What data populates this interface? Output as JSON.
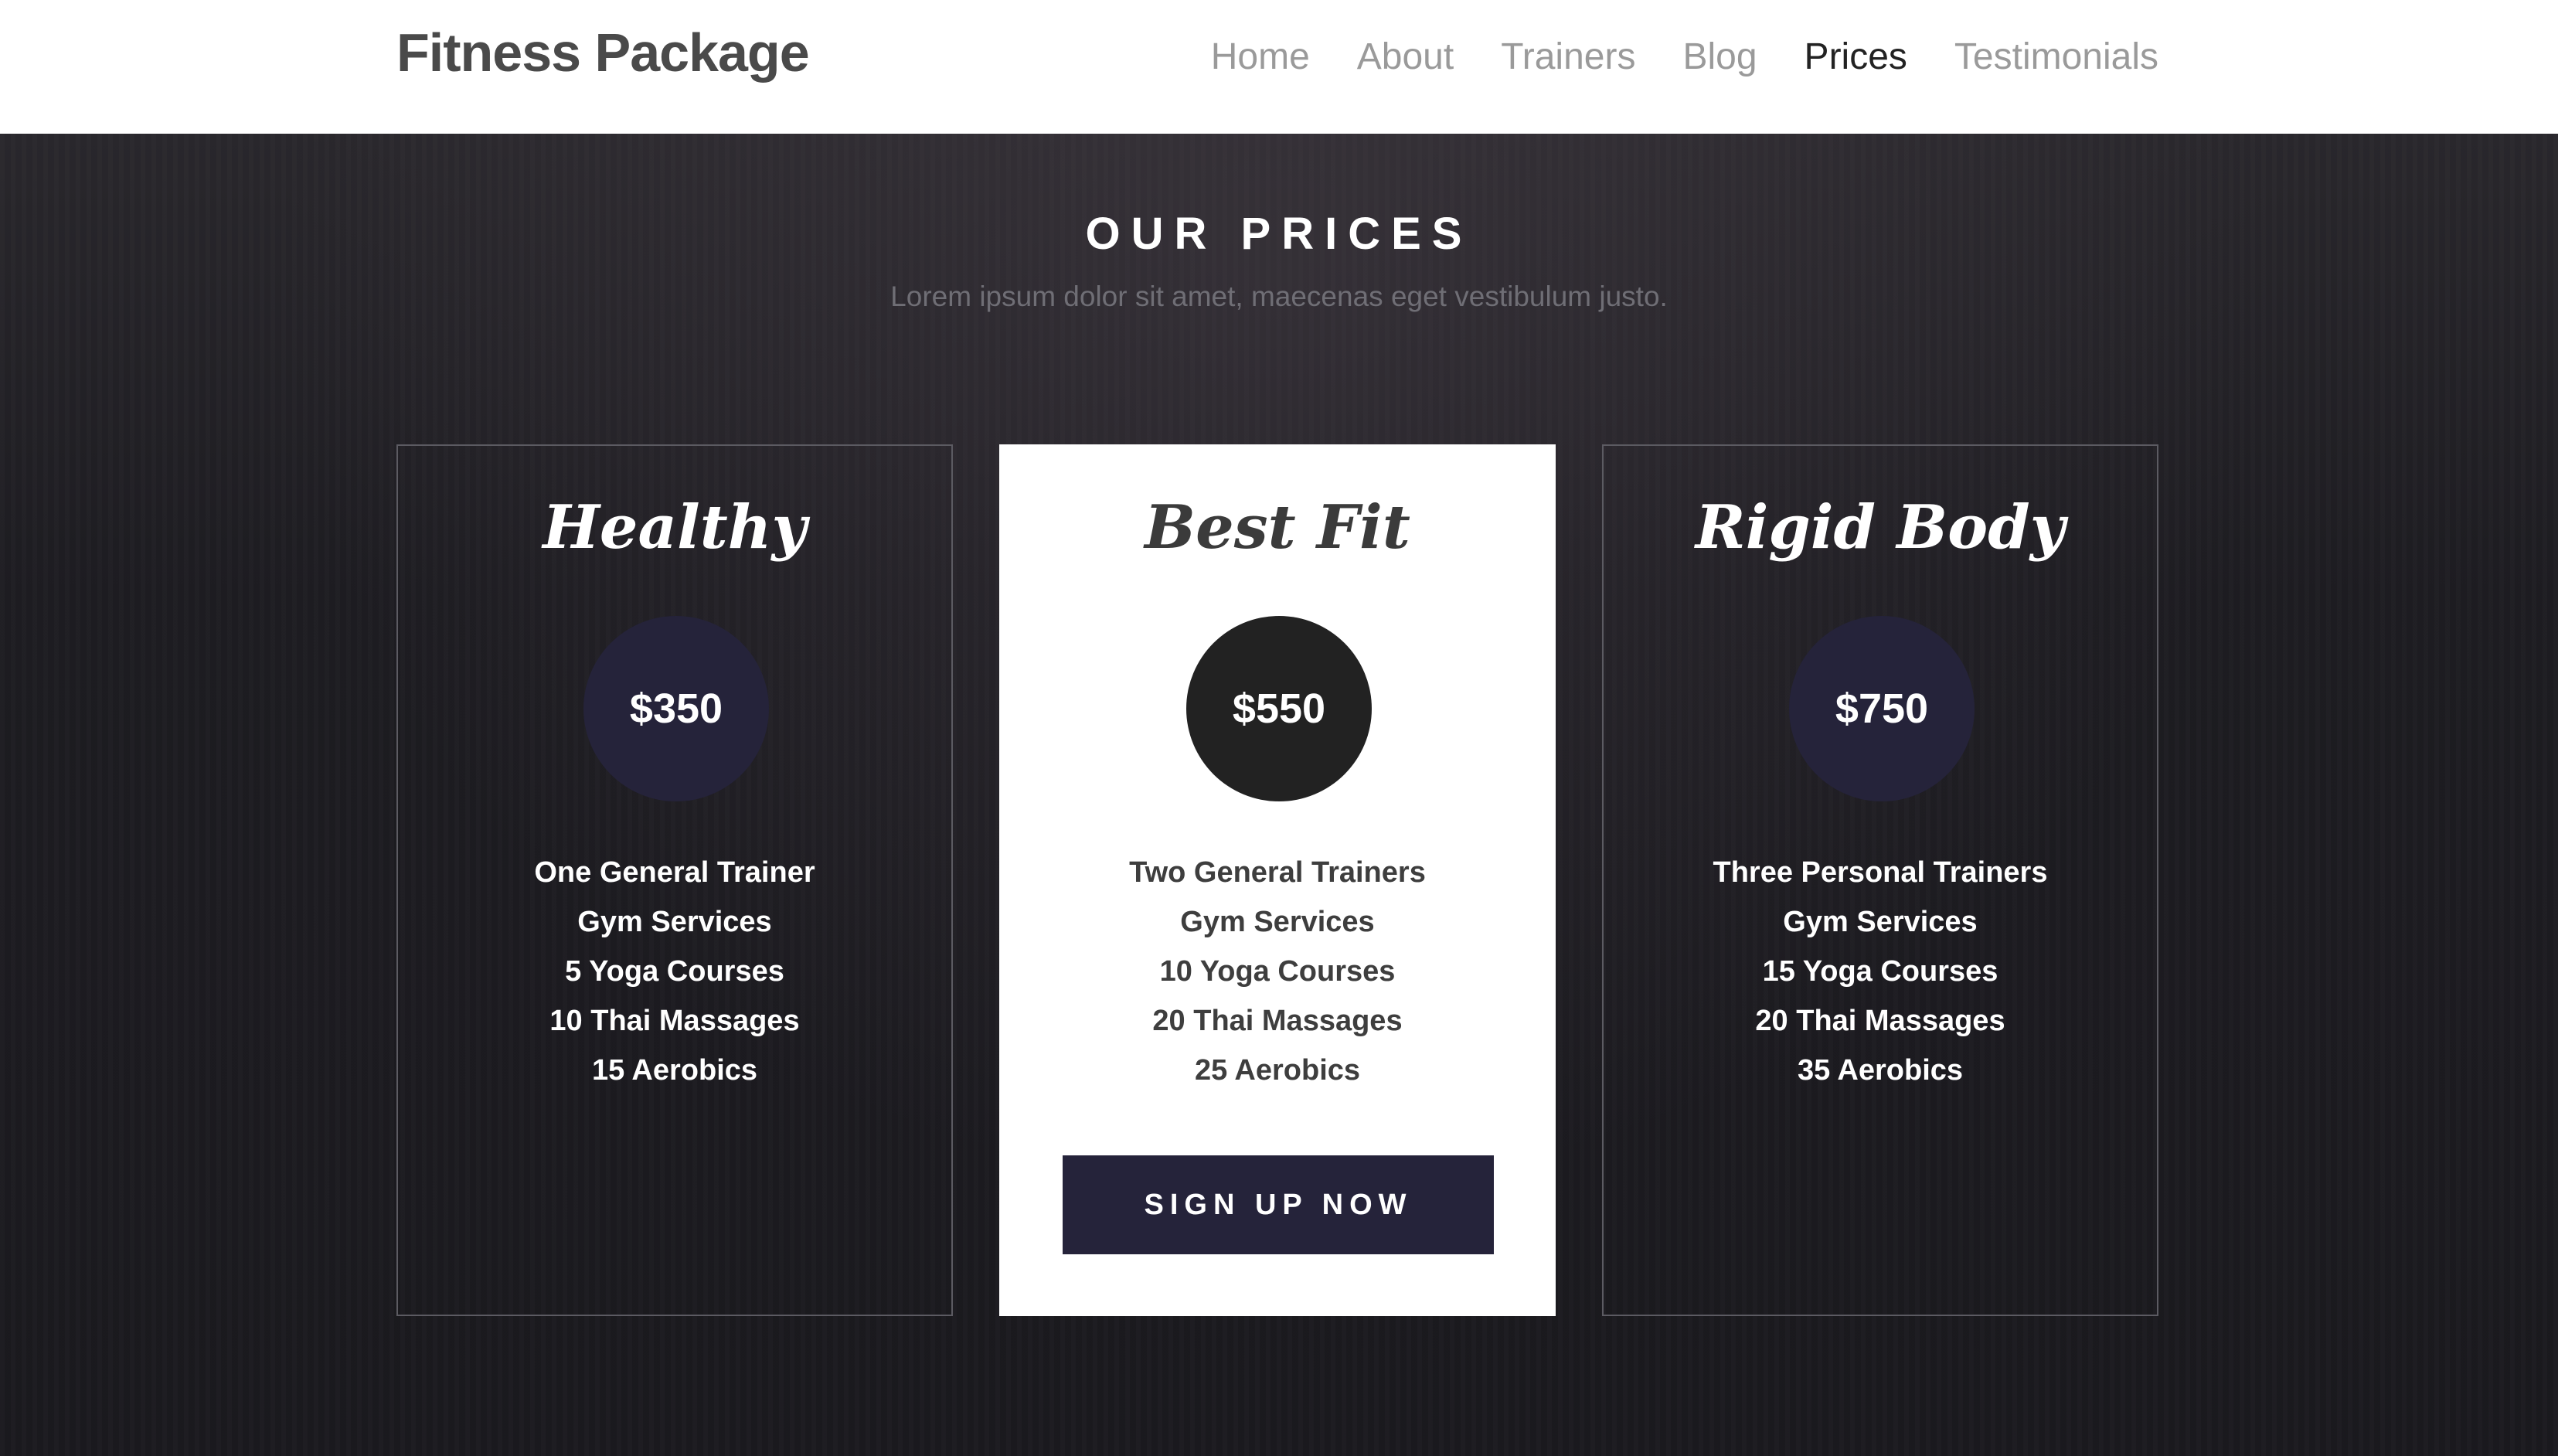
{
  "header": {
    "brand": "Fitness Package",
    "nav": [
      "Home",
      "About",
      "Trainers",
      "Blog",
      "Prices",
      "Testimonials"
    ],
    "active_nav": "Prices"
  },
  "prices": {
    "title": "OUR PRICES",
    "subtitle": "Lorem ipsum dolor sit amet, maecenas eget vestibulum justo.",
    "plans": [
      {
        "name": "Healthy",
        "price": "$350",
        "features": [
          "One General Trainer",
          "Gym Services",
          "5 Yoga Courses",
          "10 Thai Massages",
          "15 Aerobics"
        ]
      },
      {
        "name": "Best Fit",
        "price": "$550",
        "features": [
          "Two General Trainers",
          "Gym Services",
          "10 Yoga Courses",
          "20 Thai Massages",
          "25 Aerobics"
        ],
        "cta": "SIGN UP NOW"
      },
      {
        "name": "Rigid Body",
        "price": "$750",
        "features": [
          "Three Personal Trainers",
          "Gym Services",
          "15 Yoga Courses",
          "20 Thai Massages",
          "35 Aerobics"
        ]
      }
    ]
  },
  "colors": {
    "header_bg": "#ffffff",
    "section_bg": "#1f1e23",
    "accent": "#25233a",
    "featured_circle": "#222222"
  }
}
